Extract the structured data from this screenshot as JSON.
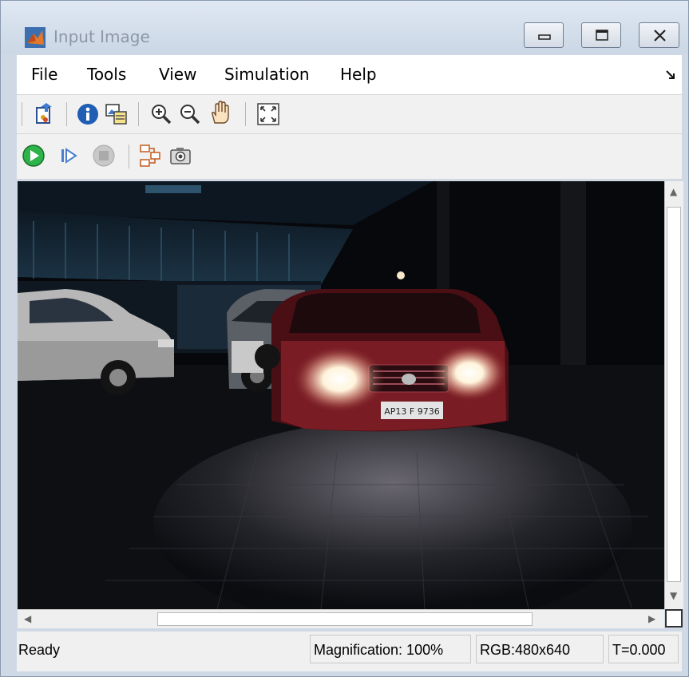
{
  "window": {
    "title": "Input Image"
  },
  "menu": [
    "File",
    "Tools",
    "View",
    "Simulation",
    "Help"
  ],
  "toolbar1": [
    "open-icon",
    "info-icon",
    "copy-image-icon",
    "zoom-in-icon",
    "zoom-out-icon",
    "pan-hand-icon",
    "fit-to-window-icon"
  ],
  "toolbar2": [
    "run-icon",
    "step-forward-icon",
    "stop-icon",
    "highlight-block-icon",
    "snapshot-icon"
  ],
  "image": {
    "plate_text": "AP13 F 9736"
  },
  "status": {
    "state": "Ready",
    "magnification": "Magnification: 100%",
    "format": "RGB:480x640",
    "time": "T=0.000"
  },
  "colors": {
    "titlebar": "#cfd9e6",
    "image_bg": "#080a0e",
    "run_green": "#2db34a"
  }
}
